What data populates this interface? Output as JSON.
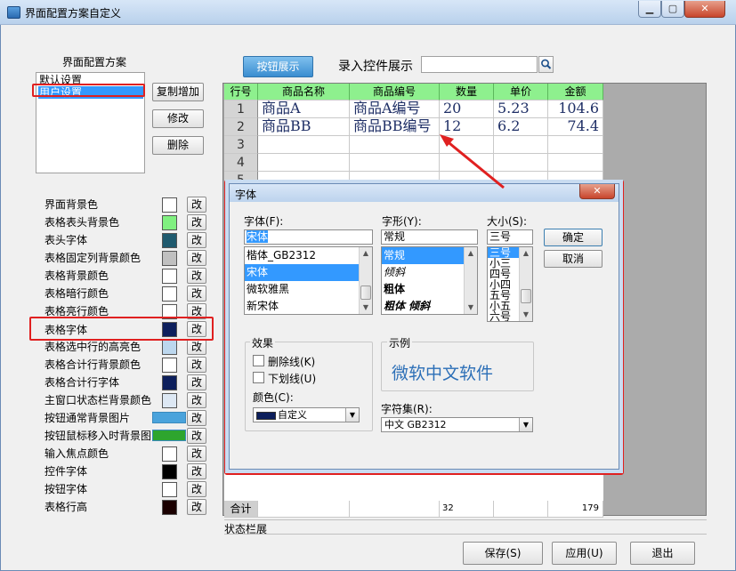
{
  "window": {
    "title": "界面配置方案自定义",
    "minimize": "▁",
    "maximize": "▢",
    "close": "✕"
  },
  "scheme": {
    "label": "界面配置方案",
    "items": [
      "默认设置",
      "用户设置"
    ],
    "copy_add": "复制增加",
    "modify": "修改",
    "delete": "删除"
  },
  "settings": [
    {
      "label": "界面背景色",
      "color": "#ffffff"
    },
    {
      "label": "表格表头背景色",
      "color": "#80f080"
    },
    {
      "label": "表头字体",
      "color": "#1f5a6e"
    },
    {
      "label": "表格固定列背景颜色",
      "color": "#c0c0c0"
    },
    {
      "label": "表格背景颜色",
      "color": "#ffffff"
    },
    {
      "label": "表格暗行颜色",
      "color": "#ffffff"
    },
    {
      "label": "表格亮行颜色",
      "color": "#ffffff"
    },
    {
      "label": "表格字体",
      "color": "#0d1f5c"
    },
    {
      "label": "表格选中行的高亮色",
      "color": "#bcd7ee"
    },
    {
      "label": "表格合计行背景颜色",
      "color": "#ffffff"
    },
    {
      "label": "表格合计行字体",
      "color": "#0d1f5c"
    },
    {
      "label": "主窗口状态栏背景颜色",
      "color": "#dde8f4"
    },
    {
      "label": "按钮通常背景图片",
      "color": "#4aa3dc"
    },
    {
      "label": "按钮鼠标移入时背景图",
      "color": "#2ea52e"
    },
    {
      "label": "输入焦点颜色",
      "color": "#ffffff"
    },
    {
      "label": "控件字体",
      "color": "#000000"
    },
    {
      "label": "按钮字体",
      "color": "#ffffff"
    },
    {
      "label": "表格行高",
      "color": "#1a0000"
    }
  ],
  "change_label": "改",
  "tabs": {
    "button_display": "按钮展示",
    "input_display": "录入控件展示"
  },
  "grid": {
    "headers": [
      "行号",
      "商品名称",
      "商品编号",
      "数量",
      "单价",
      "金额"
    ],
    "rows": [
      [
        "1",
        "商品A",
        "商品A编号",
        "20",
        "5.23",
        "104.6"
      ],
      [
        "2",
        "商品BB",
        "商品BB编号",
        "12",
        "6.2",
        "74.4"
      ],
      [
        "3",
        "",
        "",
        "",
        "",
        ""
      ],
      [
        "4",
        "",
        "",
        "",
        "",
        ""
      ],
      [
        "5",
        "",
        "",
        "",
        "",
        ""
      ]
    ],
    "total_label": "合计",
    "total_qty": "32",
    "total_amount": "179"
  },
  "status_bar": "状态栏展",
  "buttons": {
    "save": "保存(S)",
    "apply": "应用(U)",
    "exit": "退出"
  },
  "font_dialog": {
    "title": "字体",
    "close": "✕",
    "font_label": "字体(F):",
    "style_label": "字形(Y):",
    "size_label": "大小(S):",
    "font_value": "宋体",
    "style_value": "常规",
    "size_value": "三号",
    "fonts": [
      "楷体_GB2312",
      "宋体",
      "微软雅黑",
      "新宋体"
    ],
    "styles": [
      "常规",
      "倾斜",
      "粗体",
      "粗体 倾斜"
    ],
    "sizes": [
      "三号",
      "小三",
      "四号",
      "小四",
      "五号",
      "小五",
      "六号"
    ],
    "ok": "确定",
    "cancel": "取消",
    "effects_label": "效果",
    "strikeout": "删除线(K)",
    "underline": "下划线(U)",
    "color_label": "颜色(C):",
    "color_value": "自定义",
    "color_swatch": "#0d1f5c",
    "sample_label": "示例",
    "sample_text": "微软中文软件",
    "charset_label": "字符集(R):",
    "charset_value": "中文 GB2312"
  }
}
